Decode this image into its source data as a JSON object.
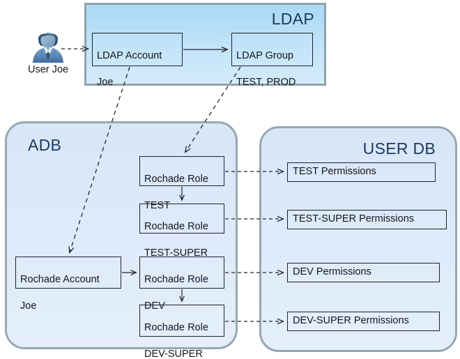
{
  "diagram": {
    "title": "LDAP to Rochade role permission mapping",
    "colors": {
      "ldap_panel_fill_top": "#a9d8f4",
      "ldap_panel_fill_bottom": "#d4ecfb",
      "ldap_panel_border": "#8fa3aa",
      "db_panel_fill": "#dfebfa",
      "db_panel_border": "#96a8b0",
      "node_border": "#20222b",
      "text": "#15161c",
      "panel_title_text": "#1b3a5c",
      "connector": "#1f2430",
      "avatar_primary": "#4a7fb5",
      "avatar_hair": "#35506b"
    }
  },
  "actor": {
    "icon": "user-avatar-icon",
    "label": "User Joe"
  },
  "containers": {
    "ldap": {
      "title": "LDAP"
    },
    "adb": {
      "title": "ADB"
    },
    "userdb": {
      "title": "USER DB"
    }
  },
  "nodes": {
    "ldap_account": {
      "line1": "LDAP Account",
      "line2": "Joe"
    },
    "ldap_group": {
      "line1": "LDAP Group",
      "line2": "TEST, PROD"
    },
    "role_test": {
      "line1": "Rochade Role",
      "line2": "TEST"
    },
    "role_test_super": {
      "line1": "Rochade Role",
      "line2": "TEST-SUPER"
    },
    "rochade_account": {
      "line1": "Rochade Account",
      "line2": "Joe"
    },
    "role_dev": {
      "line1": "Rochade Role",
      "line2": "DEV"
    },
    "role_dev_super": {
      "line1": "Rochade Role",
      "line2": "DEV-SUPER"
    },
    "perm_test": {
      "label": "TEST Permissions"
    },
    "perm_test_super": {
      "label": "TEST-SUPER  Permissions"
    },
    "perm_dev": {
      "label": "DEV Permissions"
    },
    "perm_dev_super": {
      "label": "DEV-SUPER  Permissions"
    }
  },
  "connectors": [
    {
      "from": "User Joe",
      "to": "LDAP Account Joe",
      "style": "dashed"
    },
    {
      "from": "LDAP Account Joe",
      "to": "LDAP Group TEST, PROD",
      "style": "solid"
    },
    {
      "from": "LDAP Account Joe",
      "to": "Rochade Account Joe",
      "style": "dashed"
    },
    {
      "from": "LDAP Group TEST, PROD",
      "to": "Rochade Role TEST",
      "style": "dashed"
    },
    {
      "from": "Rochade Role TEST",
      "to": "Rochade Role TEST-SUPER",
      "style": "solid"
    },
    {
      "from": "Rochade Account Joe",
      "to": "Rochade Role DEV",
      "style": "solid"
    },
    {
      "from": "Rochade Role DEV",
      "to": "Rochade Role DEV-SUPER",
      "style": "solid"
    },
    {
      "from": "Rochade Role TEST",
      "to": "TEST Permissions",
      "style": "dashed"
    },
    {
      "from": "Rochade Role TEST-SUPER",
      "to": "TEST-SUPER  Permissions",
      "style": "dashed"
    },
    {
      "from": "Rochade Role DEV",
      "to": "DEV Permissions",
      "style": "dashed"
    },
    {
      "from": "Rochade Role DEV-SUPER",
      "to": "DEV-SUPER  Permissions",
      "style": "dashed"
    }
  ]
}
